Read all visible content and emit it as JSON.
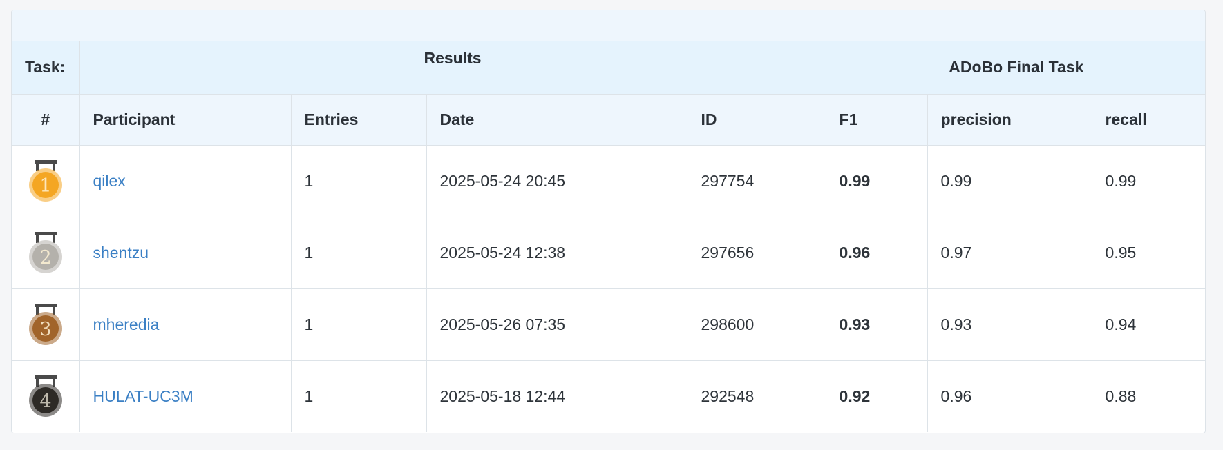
{
  "task_header": {
    "label": "Task:",
    "results_label": "Results",
    "task_name": "ADoBo Final Task"
  },
  "columns": {
    "rank": "#",
    "participant": "Participant",
    "entries": "Entries",
    "date": "Date",
    "id": "ID",
    "f1": "F1",
    "precision": "precision",
    "recall": "recall"
  },
  "medal_colors": {
    "gold": "#f4a623",
    "silver": "#b4b1ab",
    "bronze": "#a1642a",
    "other": "#2d2a26"
  },
  "rows": [
    {
      "rank": "1",
      "participant": "qilex",
      "entries": "1",
      "date": "2025-05-24 20:45",
      "id": "297754",
      "f1": "0.99",
      "precision": "0.99",
      "recall": "0.99",
      "medal": "gold-medal-icon"
    },
    {
      "rank": "2",
      "participant": "shentzu",
      "entries": "1",
      "date": "2025-05-24 12:38",
      "id": "297656",
      "f1": "0.96",
      "precision": "0.97",
      "recall": "0.95",
      "medal": "silver-medal-icon"
    },
    {
      "rank": "3",
      "participant": "mheredia",
      "entries": "1",
      "date": "2025-05-26 07:35",
      "id": "298600",
      "f1": "0.93",
      "precision": "0.93",
      "recall": "0.94",
      "medal": "bronze-medal-icon"
    },
    {
      "rank": "4",
      "participant": "HULAT-UC3M",
      "entries": "1",
      "date": "2025-05-18 12:44",
      "id": "292548",
      "f1": "0.92",
      "precision": "0.96",
      "recall": "0.88",
      "medal": "rank-medal-icon"
    }
  ]
}
